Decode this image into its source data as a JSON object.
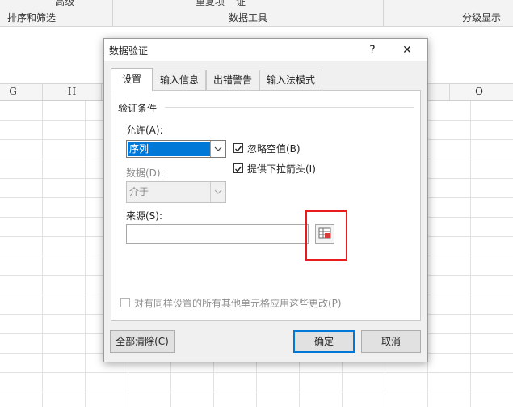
{
  "ribbon": {
    "cut_left": "高级",
    "cut_mid1": "重复项",
    "cut_mid2": "证",
    "group_sort_filter": "排序和筛选",
    "group_data_tools": "数据工具",
    "group_outline": "分级显示"
  },
  "columns": {
    "g": "G",
    "h": "H",
    "o": "O"
  },
  "dialog": {
    "title": "数据验证",
    "help_icon": "?",
    "close_icon": "✕",
    "tabs": [
      "设置",
      "输入信息",
      "出错警告",
      "输入法模式"
    ],
    "section_title": "验证条件",
    "allow_label": "允许(A):",
    "allow_value": "序列",
    "data_label": "数据(D):",
    "data_value": "介于",
    "ignore_blank_label": "忽略空值(B)",
    "ignore_blank_checked": true,
    "dropdown_label": "提供下拉箭头(I)",
    "dropdown_checked": true,
    "source_label": "来源(S):",
    "source_value": "",
    "apply_all_label": "对有同样设置的所有其他单元格应用这些更改(P)",
    "apply_all_checked": false,
    "clear_all_button": "全部清除(C)",
    "ok_button": "确定",
    "cancel_button": "取消"
  },
  "colors": {
    "accent": "#0078d7",
    "highlight": "#e81c1c"
  }
}
